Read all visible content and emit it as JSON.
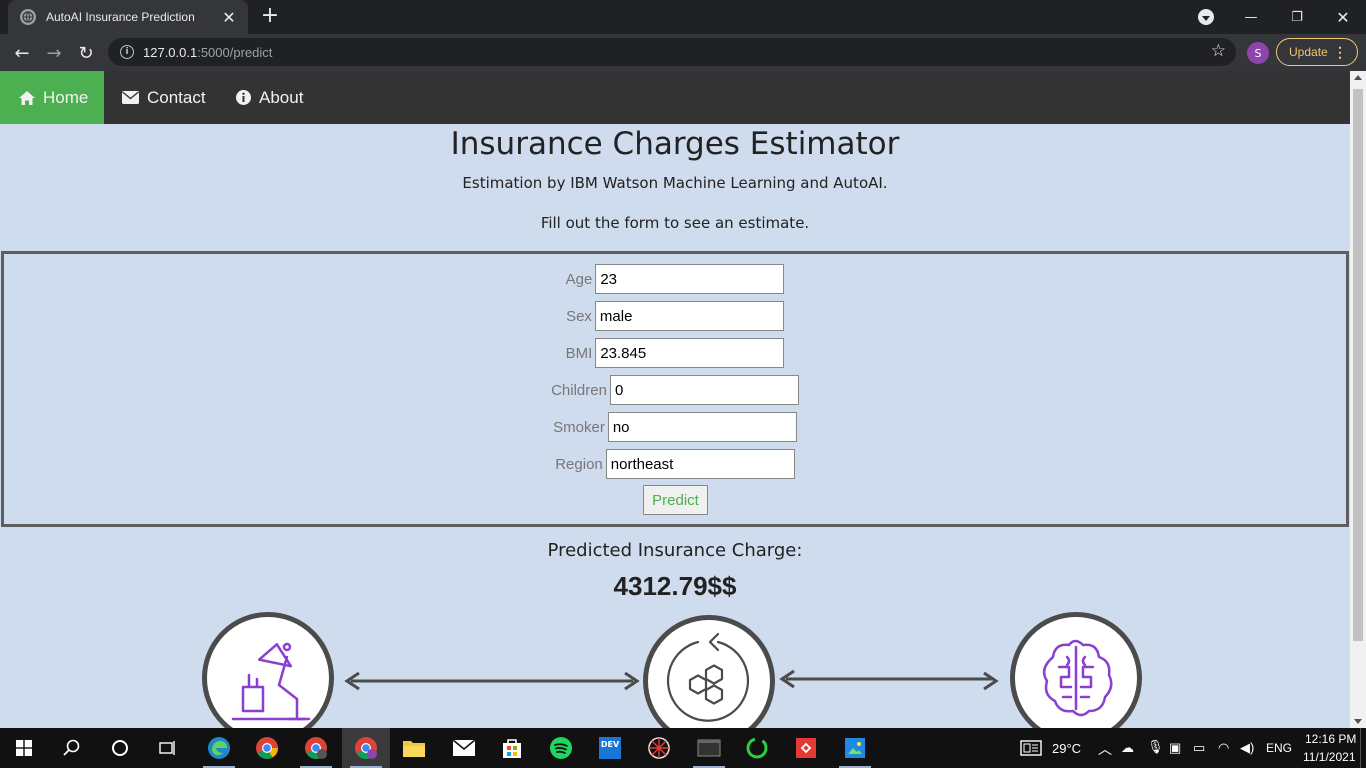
{
  "browser": {
    "tab_title": "AutoAI Insurance Prediction",
    "url_host": "127.0.0.1",
    "url_path": ":5000/predict",
    "profile_initial": "S",
    "update_label": "Update"
  },
  "nav": {
    "items": [
      {
        "label": "Home",
        "icon": "home-icon",
        "active": true
      },
      {
        "label": "Contact",
        "icon": "envelope-icon",
        "active": false
      },
      {
        "label": "About",
        "icon": "info-circle-icon",
        "active": false
      }
    ]
  },
  "header": {
    "title": "Insurance Charges Estimator",
    "subtitle": "Estimation by IBM Watson Machine Learning and AutoAI.",
    "instruction": "Fill out the form to see an estimate."
  },
  "form": {
    "fields": [
      {
        "label": "Age",
        "value": "23"
      },
      {
        "label": "Sex",
        "value": "male"
      },
      {
        "label": "BMI",
        "value": "23.845"
      },
      {
        "label": "Children",
        "value": "0"
      },
      {
        "label": "Smoker",
        "value": "no"
      },
      {
        "label": "Region",
        "value": "northeast"
      }
    ],
    "submit_label": "Predict"
  },
  "result": {
    "label": "Predicted Insurance Charge:",
    "value": "4312.79$$"
  },
  "diagram": {
    "icons": [
      "desk-lamp-icon",
      "hexagon-cycle-icon",
      "brain-icon"
    ],
    "accent_color": "#8a3fd1"
  },
  "taskbar": {
    "weather": "29°C",
    "language": "ENG",
    "time": "12:16 PM",
    "date": "11/1/2021"
  },
  "colors": {
    "nav_bg": "#333333",
    "nav_active": "#4caf50",
    "page_bg": "#cfdcee"
  }
}
